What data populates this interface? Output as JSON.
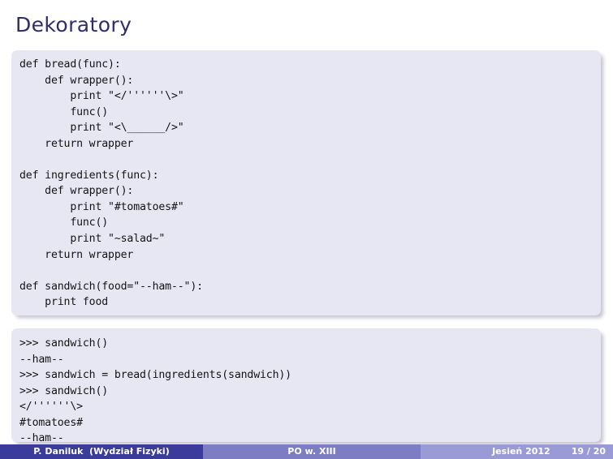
{
  "slide": {
    "title": "Dekoratory"
  },
  "code_block_definitions": {
    "language": "python",
    "text": "def bread(func):\n    def wrapper():\n        print \"</''''''\\>\"\n        func()\n        print \"<\\______/>\"\n    return wrapper\n\ndef ingredients(func):\n    def wrapper():\n        print \"#tomatoes#\"\n        func()\n        print \"~salad~\"\n    return wrapper\n\ndef sandwich(food=\"--ham--\"):\n    print food"
  },
  "code_block_session": {
    "language": "python-console",
    "text": ">>> sandwich()\n--ham--\n>>> sandwich = bread(ingredients(sandwich))\n>>> sandwich()\n</''''''\\>\n#tomatoes#\n--ham--"
  },
  "footer": {
    "author": "P. Daniluk  (Wydział Fizyki)",
    "presentation_title": "PO w. XIII",
    "date": "Jesień 2012",
    "page": "19 / 20"
  },
  "colors": {
    "title": "#2e2e6e",
    "code_background": "#e7e7f4",
    "footer_left": "#3b3b9c",
    "footer_middle": "#7d7dc4",
    "footer_right": "#9a9ad6",
    "slide_background": "#ffffff"
  }
}
